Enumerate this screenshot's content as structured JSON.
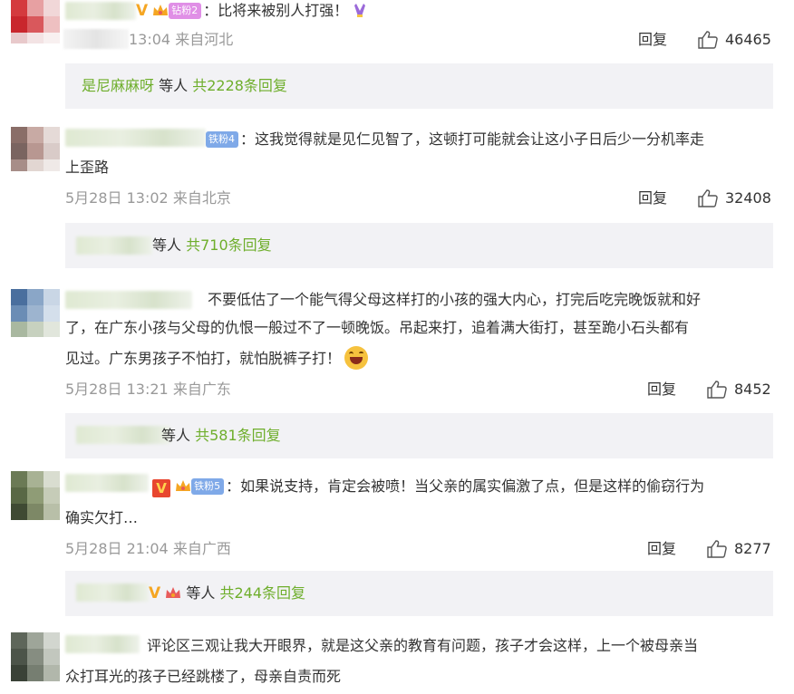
{
  "comments": [
    {
      "badge": "钻粉2",
      "text": "：比将来被别人打强！",
      "time": "13:04 来自河北",
      "reply_label": "回复",
      "likes": "46465",
      "sub": {
        "name": "是尼麻麻呀",
        "middle": " 等人 ",
        "count": "共2228条回复"
      }
    },
    {
      "badge": "铁粉4",
      "line1": "：这我觉得就是见仁见智了，这顿打可能就会让这小子日后少一分机率走",
      "line2": "上歪路",
      "time": "5月28日 13:02 来自北京",
      "reply_label": "回复",
      "likes": "32408",
      "sub": {
        "middle": "等人 ",
        "count": "共710条回复"
      }
    },
    {
      "line1": "不要低估了一个能气得父母这样打的小孩的强大内心，打完后吃完晚饭就和好",
      "line2": "了，在广东小孩与父母的仇恨一般过不了一顿晚饭。吊起来打，追着满大街打，甚至跪小石头都有",
      "line3": "见过。广东男孩子不怕打，就怕脱裤子打！",
      "time": "5月28日 13:21 来自广东",
      "reply_label": "回复",
      "likes": "8452",
      "sub": {
        "middle": "等人 ",
        "count": "共581条回复"
      }
    },
    {
      "badge": "铁粉5",
      "line1": "：如果说支持，肯定会被喷！当父亲的属实偏激了点，但是这样的偷窃行为",
      "line2": "确实欠打…",
      "time": "5月28日 21:04 来自广西",
      "reply_label": "回复",
      "likes": "8277",
      "sub": {
        "middle": "等人 ",
        "count": "共244条回复"
      }
    },
    {
      "line1": "评论区三观让我大开眼界，就是这父亲的教育有问题，孩子才会这样，上一个被母亲当",
      "line2": "众打耳光的孩子已经跳楼了，母亲自责而死"
    }
  ],
  "icons": {
    "like": "thumbs-up-icon",
    "vip": "vip-v-icon",
    "crown": "crown-icon",
    "emoji": "grinning-face-icon"
  },
  "colors": {
    "green_link": "#6eae2b",
    "meta_gray": "#999999",
    "subbox_bg": "#f2f2f5",
    "vip_gold": "#f5a623"
  }
}
